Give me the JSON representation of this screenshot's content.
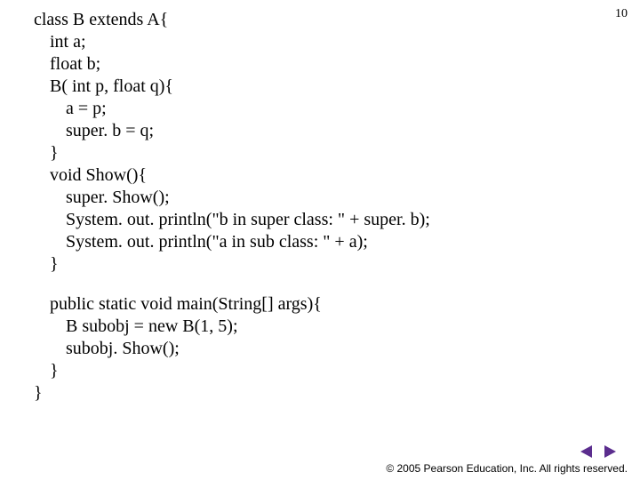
{
  "page_number": "10",
  "code": {
    "p1": {
      "l01": "class B extends A{",
      "l02": "int a;",
      "l03": "float b;",
      "l04": "B( int p, float q){",
      "l05": "a = p;",
      "l06": "super. b = q;",
      "l07": "}",
      "l08": "void Show(){",
      "l09": "super. Show();",
      "l10": "System. out. println(\"b in super class:  \" + super. b);",
      "l11": "System. out. println(\"a in sub class:   \" + a);",
      "l12": "}"
    },
    "p2": {
      "l01": "public static void main(String[] args){",
      "l02": "B subobj = new B(1, 5);",
      "l03": "subobj. Show();",
      "l04": "}",
      "l05": "}"
    }
  },
  "nav": {
    "prev_icon": "triangle-left-icon",
    "next_icon": "triangle-right-icon",
    "color": "#5b2d8e"
  },
  "footer": {
    "text": "© 2005 Pearson Education, Inc.  All rights reserved."
  }
}
